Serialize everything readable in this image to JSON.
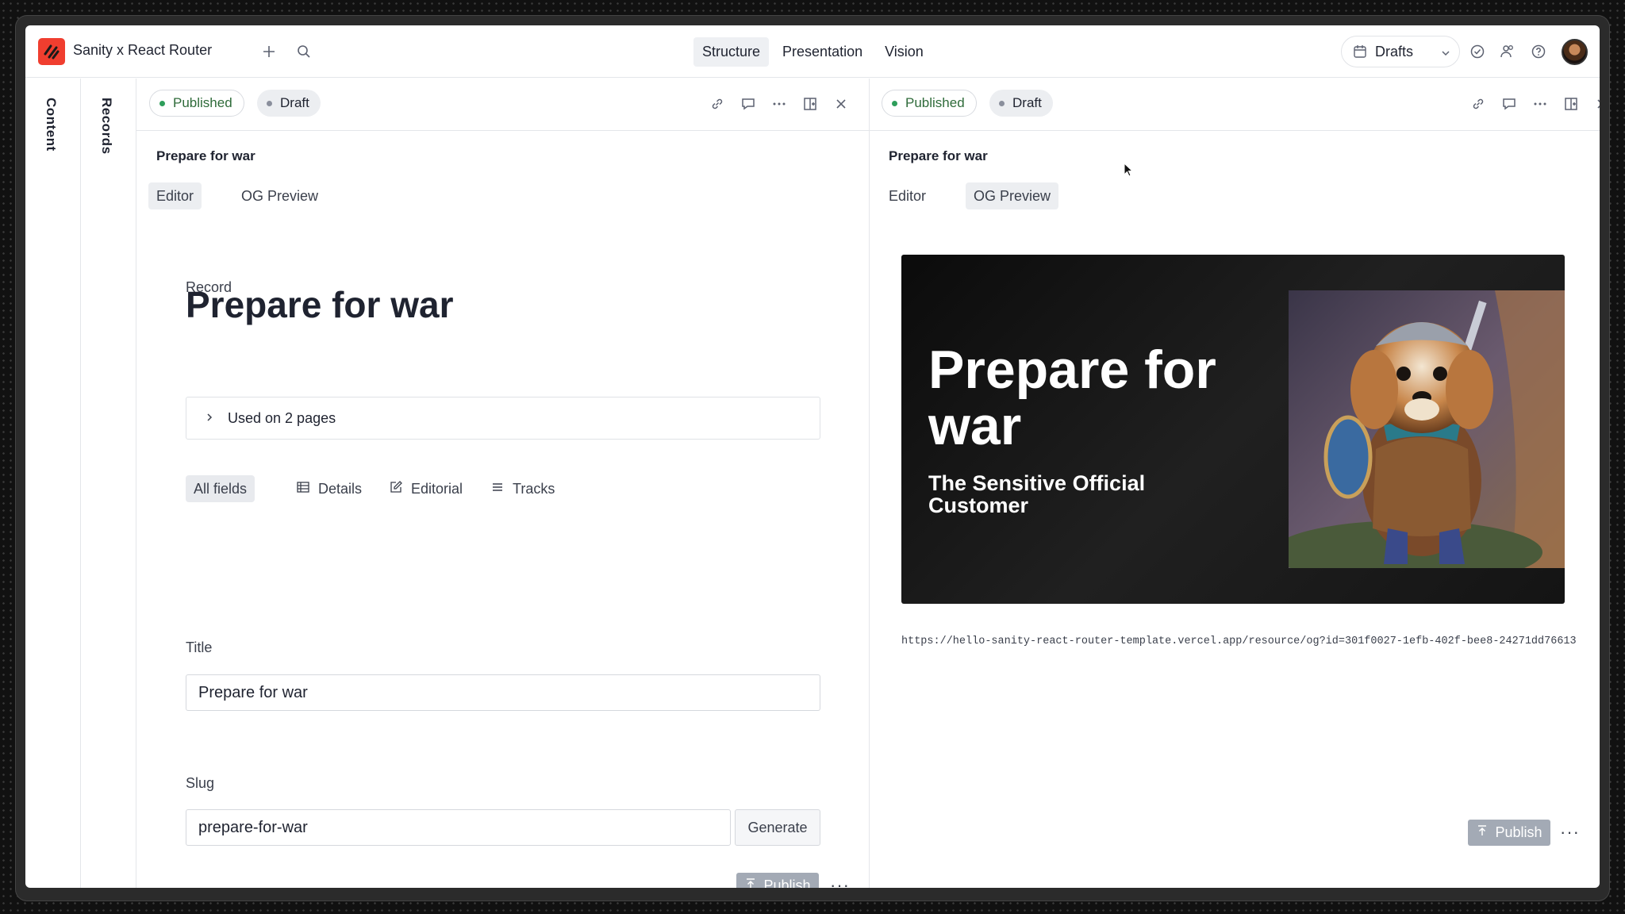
{
  "app": {
    "title": "Sanity x React Router"
  },
  "nav": {
    "tabs": [
      {
        "label": "Structure"
      },
      {
        "label": "Presentation"
      },
      {
        "label": "Vision"
      }
    ]
  },
  "perspective": {
    "label": "Drafts"
  },
  "rails": {
    "content": "Content",
    "records": "Records"
  },
  "left_pane": {
    "published": "Published",
    "draft": "Draft",
    "doc_title": "Prepare for war",
    "subtabs": {
      "editor": "Editor",
      "og_preview": "OG Preview"
    },
    "record_label": "Record",
    "heading": "Prepare for war",
    "used_on": "Used on 2 pages",
    "field_tabs": {
      "all": "All fields",
      "details": "Details",
      "editorial": "Editorial",
      "tracks": "Tracks"
    },
    "title_label": "Title",
    "title_value": "Prepare for war",
    "slug_label": "Slug",
    "slug_value": "prepare-for-war",
    "generate": "Generate",
    "publish": "Publish"
  },
  "right_pane": {
    "published": "Published",
    "draft": "Draft",
    "doc_title": "Prepare for war",
    "subtabs": {
      "editor": "Editor",
      "og_preview": "OG Preview"
    },
    "og": {
      "title": "Prepare for war",
      "subtitle": "The Sensitive Official Customer"
    },
    "url": "https://hello-sanity-react-router-template.vercel.app/resource/og?id=301f0027-1efb-402f-bee8-24271dd76613",
    "publish": "Publish"
  },
  "colors": {
    "brand": "#f03e2f",
    "published_dot": "#2e9e5b",
    "draft_dot": "#8a8f9c"
  },
  "icons": [
    "sanity-logo-icon",
    "plus-icon",
    "search-icon",
    "calendar-icon",
    "chevron-down-icon",
    "check-circle-icon",
    "users-icon",
    "help-icon",
    "link-icon",
    "comment-icon",
    "more-icon",
    "split-pane-icon",
    "close-icon",
    "chevron-right-icon",
    "table-icon",
    "edit-icon",
    "list-icon",
    "publish-icon"
  ]
}
